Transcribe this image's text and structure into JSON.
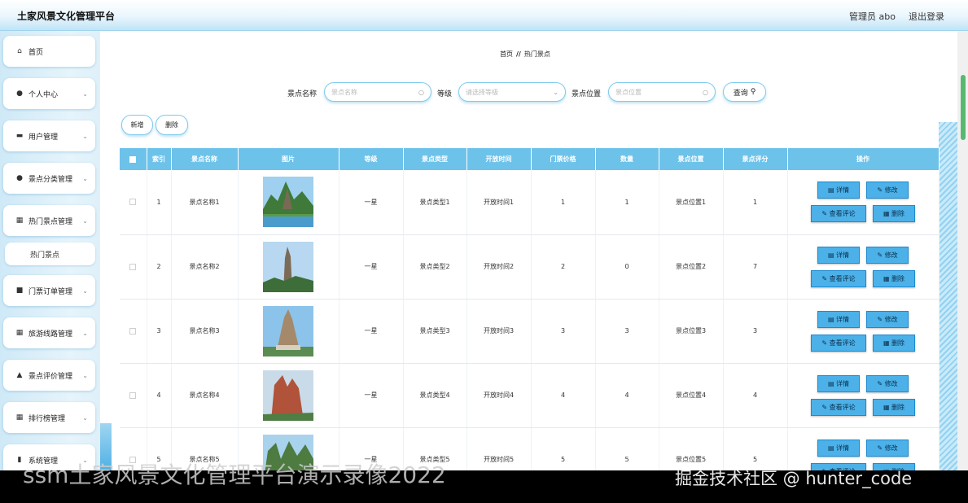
{
  "header": {
    "title": "土家风景文化管理平台",
    "admin": "管理员 abo",
    "logout": "退出登录"
  },
  "sidebar": {
    "items": [
      {
        "label": "首页",
        "icon": "home-icon",
        "chevron": false
      },
      {
        "label": "个人中心",
        "icon": "user-icon",
        "chevron": true
      },
      {
        "label": "用户管理",
        "icon": "card-icon",
        "chevron": true
      },
      {
        "label": "景点分类管理",
        "icon": "user-icon",
        "chevron": true
      },
      {
        "label": "热门景点管理",
        "icon": "grid-icon",
        "chevron": true
      },
      {
        "label": "门票订单管理",
        "icon": "ticket-icon",
        "chevron": true
      },
      {
        "label": "旅游线路管理",
        "icon": "grid-icon",
        "chevron": true
      },
      {
        "label": "景点评价管理",
        "icon": "review-icon",
        "chevron": true
      },
      {
        "label": "排行榜管理",
        "icon": "grid-icon",
        "chevron": true
      },
      {
        "label": "系统管理",
        "icon": "system-icon",
        "chevron": true
      }
    ],
    "submenu": "热门景点"
  },
  "breadcrumb": {
    "home": "首页",
    "sep": "//",
    "current": "热门景点"
  },
  "search": {
    "name_label": "景点名称",
    "name_placeholder": "景点名称",
    "level_label": "等级",
    "level_placeholder": "请选择等级",
    "location_label": "景点位置",
    "location_placeholder": "景点位置",
    "query_label": "查询"
  },
  "actions": {
    "add": "新增",
    "delete": "删除"
  },
  "table": {
    "columns": [
      "索引",
      "景点名称",
      "图片",
      "等级",
      "景点类型",
      "开放时间",
      "门票价格",
      "数量",
      "景点位置",
      "景点评分",
      "操作"
    ],
    "ops": {
      "detail": "详情",
      "edit": "修改",
      "comments": "查看评论",
      "delete": "删除"
    },
    "rows": [
      {
        "index": "1",
        "name": "景点名称1",
        "level": "一星",
        "type": "景点类型1",
        "open": "开放时间1",
        "price": "1",
        "qty": "1",
        "location": "景点位置1",
        "score": "1"
      },
      {
        "index": "2",
        "name": "景点名称2",
        "level": "一星",
        "type": "景点类型2",
        "open": "开放时间2",
        "price": "2",
        "qty": "0",
        "location": "景点位置2",
        "score": "7"
      },
      {
        "index": "3",
        "name": "景点名称3",
        "level": "一星",
        "type": "景点类型3",
        "open": "开放时间3",
        "price": "3",
        "qty": "3",
        "location": "景点位置3",
        "score": "3"
      },
      {
        "index": "4",
        "name": "景点名称4",
        "level": "一星",
        "type": "景点类型4",
        "open": "开放时间4",
        "price": "4",
        "qty": "4",
        "location": "景点位置4",
        "score": "4"
      },
      {
        "index": "5",
        "name": "景点名称5",
        "level": "一星",
        "type": "景点类型5",
        "open": "开放时间5",
        "price": "5",
        "qty": "5",
        "location": "景点位置5",
        "score": "5"
      }
    ]
  },
  "overlay": {
    "caption_left": "ssm土家风景文化管理平台演示录像2022",
    "caption_right": "掘金技术社区 @ hunter_code"
  },
  "colors": {
    "accent": "#6dc2ea",
    "button": "#4bb1e8",
    "scrollbar": "#58b870"
  }
}
